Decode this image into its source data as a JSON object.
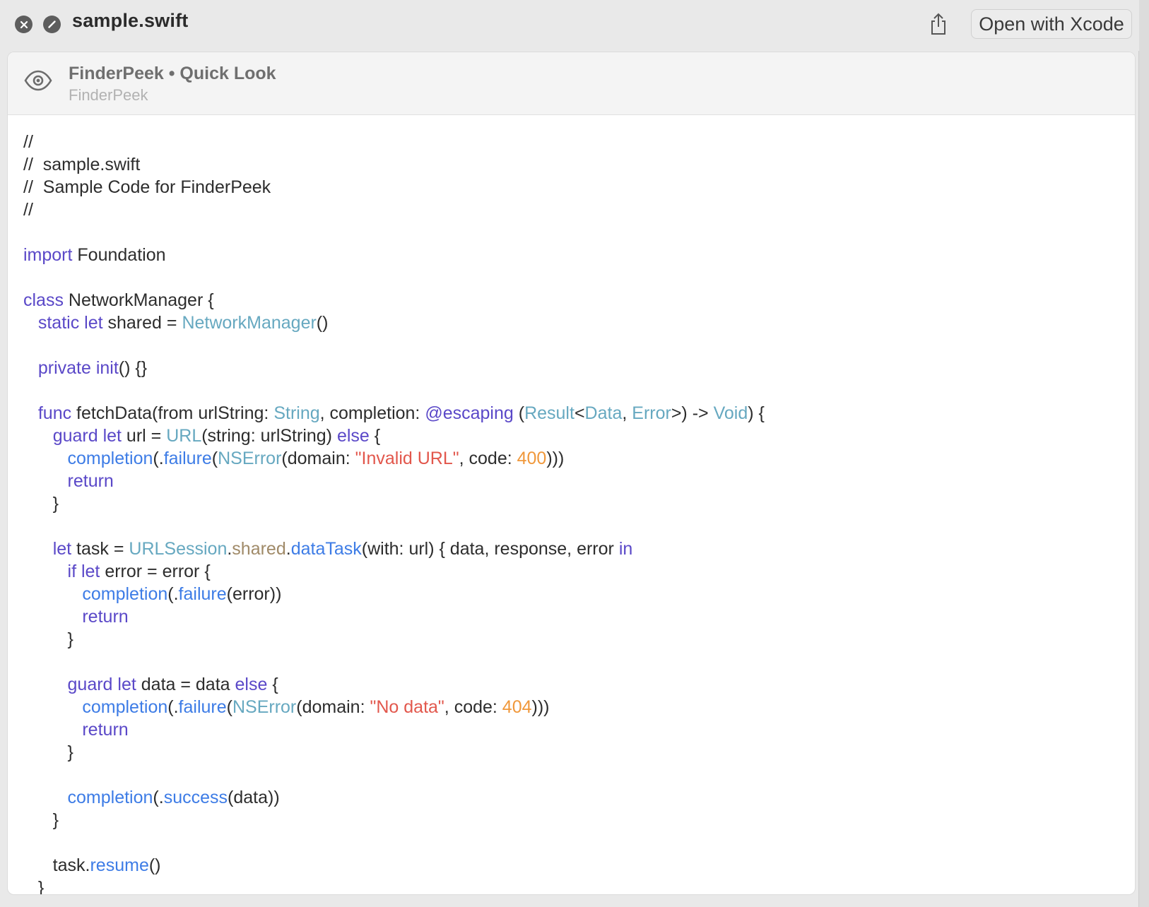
{
  "window": {
    "title": "sample.swift",
    "open_button": "Open with Xcode",
    "icons": [
      "close-icon",
      "disable-icon",
      "share-icon",
      "eye-icon"
    ]
  },
  "header": {
    "title": "FinderPeek • Quick Look",
    "subtitle": "FinderPeek"
  },
  "colors": {
    "keyword": "#5a48c8",
    "type": "#66a8c0",
    "function": "#3d7ce6",
    "string": "#e2574c",
    "number": "#f0983b",
    "property": "#a08a68",
    "text": "#2d2d2d"
  },
  "code": {
    "lines": [
      [
        [
          "cm",
          "//"
        ]
      ],
      [
        [
          "cm",
          "//  sample.swift"
        ]
      ],
      [
        [
          "cm",
          "//  Sample Code for FinderPeek"
        ]
      ],
      [
        [
          "cm",
          "//"
        ]
      ],
      [],
      [
        [
          "kw",
          "import"
        ],
        [
          "cm",
          " Foundation"
        ]
      ],
      [],
      [
        [
          "kw",
          "class"
        ],
        [
          "cm",
          " NetworkManager {"
        ]
      ],
      [
        [
          "cm",
          "   "
        ],
        [
          "kw",
          "static let"
        ],
        [
          "cm",
          " shared = "
        ],
        [
          "ty",
          "NetworkManager"
        ],
        [
          "cm",
          "()"
        ]
      ],
      [],
      [
        [
          "cm",
          "   "
        ],
        [
          "kw",
          "private init"
        ],
        [
          "cm",
          "() {}"
        ]
      ],
      [],
      [
        [
          "cm",
          "   "
        ],
        [
          "kw",
          "func"
        ],
        [
          "cm",
          " fetchData(from urlString: "
        ],
        [
          "ty",
          "String"
        ],
        [
          "cm",
          ", completion: "
        ],
        [
          "kw",
          "@escaping"
        ],
        [
          "cm",
          " ("
        ],
        [
          "ty",
          "Result"
        ],
        [
          "cm",
          "<"
        ],
        [
          "ty",
          "Data"
        ],
        [
          "cm",
          ", "
        ],
        [
          "ty",
          "Error"
        ],
        [
          "cm",
          ">) -> "
        ],
        [
          "ty",
          "Void"
        ],
        [
          "cm",
          ") {"
        ]
      ],
      [
        [
          "cm",
          "      "
        ],
        [
          "kw",
          "guard let"
        ],
        [
          "cm",
          " url = "
        ],
        [
          "ty",
          "URL"
        ],
        [
          "cm",
          "(string: urlString) "
        ],
        [
          "kw",
          "else"
        ],
        [
          "cm",
          " {"
        ]
      ],
      [
        [
          "cm",
          "         "
        ],
        [
          "fn",
          "completion"
        ],
        [
          "cm",
          "(."
        ],
        [
          "fn",
          "failure"
        ],
        [
          "cm",
          "("
        ],
        [
          "ty",
          "NSError"
        ],
        [
          "cm",
          "(domain: "
        ],
        [
          "st",
          "\"Invalid URL\""
        ],
        [
          "cm",
          ", code: "
        ],
        [
          "nm",
          "400"
        ],
        [
          "cm",
          ")))"
        ]
      ],
      [
        [
          "cm",
          "         "
        ],
        [
          "kw",
          "return"
        ]
      ],
      [
        [
          "cm",
          "      }"
        ]
      ],
      [],
      [
        [
          "cm",
          "      "
        ],
        [
          "kw",
          "let"
        ],
        [
          "cm",
          " task = "
        ],
        [
          "ty",
          "URLSession"
        ],
        [
          "cm",
          "."
        ],
        [
          "pr",
          "shared"
        ],
        [
          "cm",
          "."
        ],
        [
          "fn",
          "dataTask"
        ],
        [
          "cm",
          "(with: url) { data, response, error "
        ],
        [
          "kw",
          "in"
        ]
      ],
      [
        [
          "cm",
          "         "
        ],
        [
          "kw",
          "if let"
        ],
        [
          "cm",
          " error = error {"
        ]
      ],
      [
        [
          "cm",
          "            "
        ],
        [
          "fn",
          "completion"
        ],
        [
          "cm",
          "(."
        ],
        [
          "fn",
          "failure"
        ],
        [
          "cm",
          "(error))"
        ]
      ],
      [
        [
          "cm",
          "            "
        ],
        [
          "kw",
          "return"
        ]
      ],
      [
        [
          "cm",
          "         }"
        ]
      ],
      [],
      [
        [
          "cm",
          "         "
        ],
        [
          "kw",
          "guard let"
        ],
        [
          "cm",
          " data = data "
        ],
        [
          "kw",
          "else"
        ],
        [
          "cm",
          " {"
        ]
      ],
      [
        [
          "cm",
          "            "
        ],
        [
          "fn",
          "completion"
        ],
        [
          "cm",
          "(."
        ],
        [
          "fn",
          "failure"
        ],
        [
          "cm",
          "("
        ],
        [
          "ty",
          "NSError"
        ],
        [
          "cm",
          "(domain: "
        ],
        [
          "st",
          "\"No data\""
        ],
        [
          "cm",
          ", code: "
        ],
        [
          "nm",
          "404"
        ],
        [
          "cm",
          ")))"
        ]
      ],
      [
        [
          "cm",
          "            "
        ],
        [
          "kw",
          "return"
        ]
      ],
      [
        [
          "cm",
          "         }"
        ]
      ],
      [],
      [
        [
          "cm",
          "         "
        ],
        [
          "fn",
          "completion"
        ],
        [
          "cm",
          "(."
        ],
        [
          "fn",
          "success"
        ],
        [
          "cm",
          "(data))"
        ]
      ],
      [
        [
          "cm",
          "      }"
        ]
      ],
      [],
      [
        [
          "cm",
          "      task."
        ],
        [
          "fn",
          "resume"
        ],
        [
          "cm",
          "()"
        ]
      ],
      [
        [
          "cm",
          "   }"
        ]
      ]
    ]
  }
}
